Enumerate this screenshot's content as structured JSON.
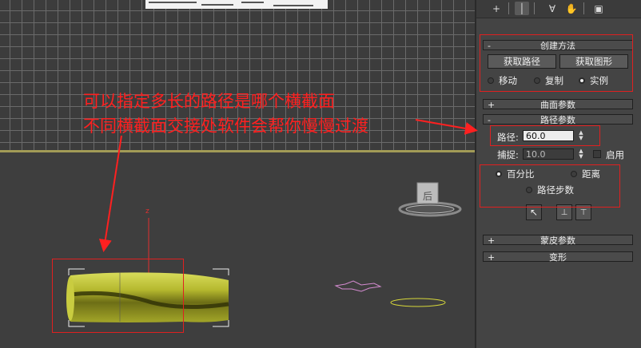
{
  "tabs": [
    "create-tab",
    "modify-tab",
    "hierarchy-tab",
    "motion-tab",
    "display-tab"
  ],
  "creation_method": {
    "title": "创建方法",
    "get_path": "获取路径",
    "get_shape": "获取图形",
    "options": [
      "移动",
      "复制",
      "实例"
    ],
    "selected": "实例"
  },
  "surface_params": {
    "title": "曲面参数"
  },
  "path_params": {
    "title": "路径参数",
    "path_label": "路径:",
    "path_value": "60.0",
    "snap_label": "捕捉:",
    "snap_value": "10.0",
    "enable_label": "启用",
    "percent_label": "百分比",
    "distance_label": "距离",
    "path_steps_label": "路径步数"
  },
  "skin_params": {
    "title": "蒙皮参数"
  },
  "deformation": {
    "title": "变形"
  },
  "annotation": {
    "line1": "可以指定多长的路径是哪个横截面",
    "line2": "不同横截面交接处软件会帮你慢慢过渡"
  },
  "viewport": {
    "axis_z": "z",
    "viewcube_label": "后"
  },
  "colors": {
    "annotation_red": "#ff2020",
    "object_green": "#b5b82e",
    "viewport_border": "#a29b56"
  }
}
